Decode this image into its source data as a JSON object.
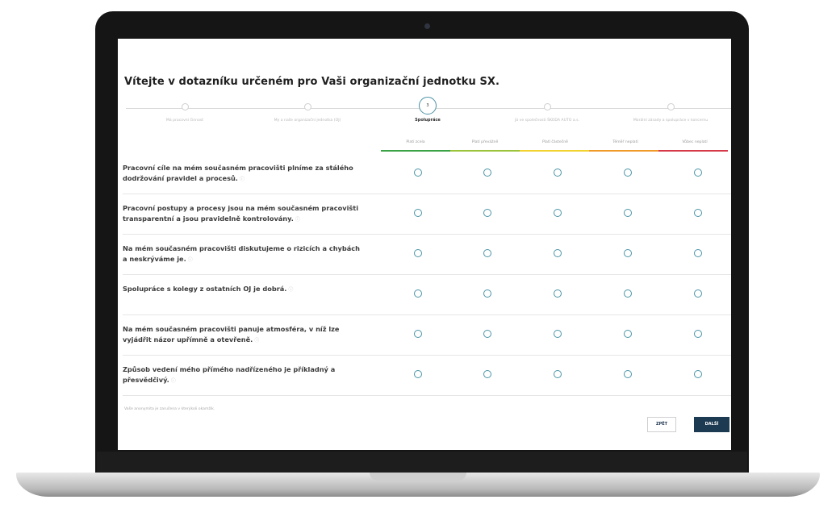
{
  "survey": {
    "title": "Vítejte v dotazníku určeném pro Vaši organizační jednotku SX.",
    "steps": [
      {
        "number": "",
        "label": "Má pracovní činnost",
        "state": "inactive"
      },
      {
        "number": "",
        "label": "My a naše organizační jednotka (OJ)",
        "state": "inactive"
      },
      {
        "number": "3",
        "label": "Spolupráce",
        "state": "active"
      },
      {
        "number": "",
        "label": "Já ve společnosti ŠKODA AUTO a.s.",
        "state": "inactive"
      },
      {
        "number": "",
        "label": "Morální zásady a spolupráce v koncernu",
        "state": "inactive"
      }
    ],
    "scale": [
      {
        "label": "Platí zcela",
        "color": "#3aa346"
      },
      {
        "label": "Platí převážně",
        "color": "#9cc43b"
      },
      {
        "label": "Platí částečně",
        "color": "#f2d22e"
      },
      {
        "label": "Téměř neplatí",
        "color": "#f09a2a"
      },
      {
        "label": "Vůbec neplatí",
        "color": "#d63a4a"
      }
    ],
    "questions": [
      {
        "text": "Pracovní cíle na mém současném pracovišti plníme za stálého dodržování pravidel a procesů.",
        "info": "ⓘ"
      },
      {
        "text": "Pracovní postupy a procesy jsou na mém současném pracovišti transparentní a jsou pravidelně kontrolovány.",
        "info": "ⓘ"
      },
      {
        "text": "Na mém současném pracovišti diskutujeme o rizicích a chybách a neskrýváme je.",
        "info": "ⓘ"
      },
      {
        "text": "Spolupráce s kolegy z ostatních OJ je dobrá.",
        "info": "ⓘ"
      },
      {
        "text": "Na mém současném pracovišti panuje atmosféra, v níž lze vyjádřit názor upřímně a otevřeně.",
        "info": "ⓘ"
      },
      {
        "text": "Způsob vedení mého přímého nadřízeného je příkladný a přesvědčivý.",
        "info": "ⓘ"
      }
    ],
    "anonymity_note": "Vaše anonymita je zaručena v kterýkoli okamžik.",
    "back_label": "ZPĚT",
    "next_label": "DALŠÍ"
  }
}
